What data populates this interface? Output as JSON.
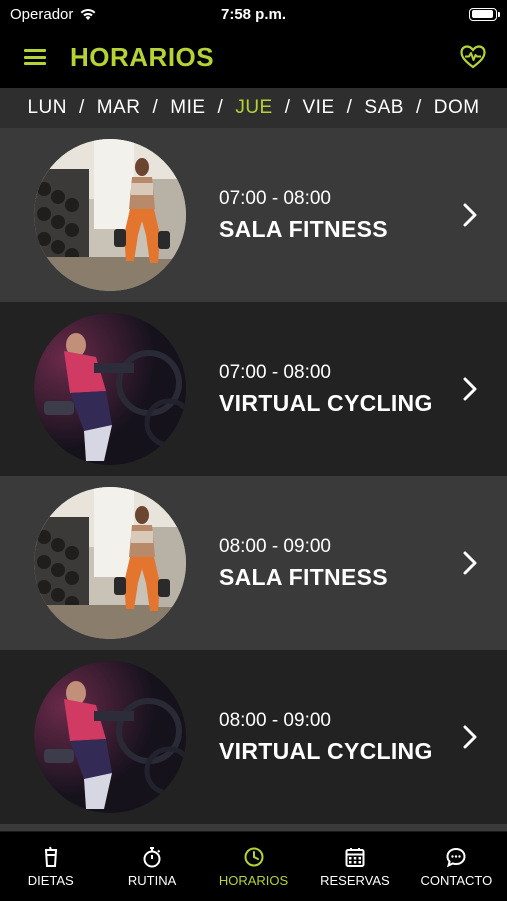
{
  "status_bar": {
    "carrier": "Operador",
    "time": "7:58 p.m."
  },
  "header": {
    "title": "HORARIOS"
  },
  "days": [
    {
      "label": "LUN",
      "active": false
    },
    {
      "label": "MAR",
      "active": false
    },
    {
      "label": "MIE",
      "active": false
    },
    {
      "label": "JUE",
      "active": true
    },
    {
      "label": "VIE",
      "active": false
    },
    {
      "label": "SAB",
      "active": false
    },
    {
      "label": "DOM",
      "active": false
    }
  ],
  "day_separator": "/",
  "classes": [
    {
      "time": "07:00 - 08:00",
      "name": "SALA FITNESS",
      "image": "fitness-photo"
    },
    {
      "time": "07:00 - 08:00",
      "name": "VIRTUAL CYCLING",
      "image": "cycling-photo"
    },
    {
      "time": "08:00 - 09:00",
      "name": "SALA FITNESS",
      "image": "fitness-photo"
    },
    {
      "time": "08:00 - 09:00",
      "name": "VIRTUAL CYCLING",
      "image": "cycling-photo"
    }
  ],
  "tabs": [
    {
      "label": "DIETAS",
      "icon": "cup-icon",
      "active": false
    },
    {
      "label": "RUTINA",
      "icon": "stopwatch-icon",
      "active": false
    },
    {
      "label": "HORARIOS",
      "icon": "clock-icon",
      "active": true
    },
    {
      "label": "RESERVAS",
      "icon": "calendar-icon",
      "active": false
    },
    {
      "label": "CONTACTO",
      "icon": "chat-icon",
      "active": false
    }
  ],
  "colors": {
    "accent": "#b5d334",
    "row_light": "#3a3a3a",
    "row_dark": "#222222",
    "background": "#000000"
  }
}
